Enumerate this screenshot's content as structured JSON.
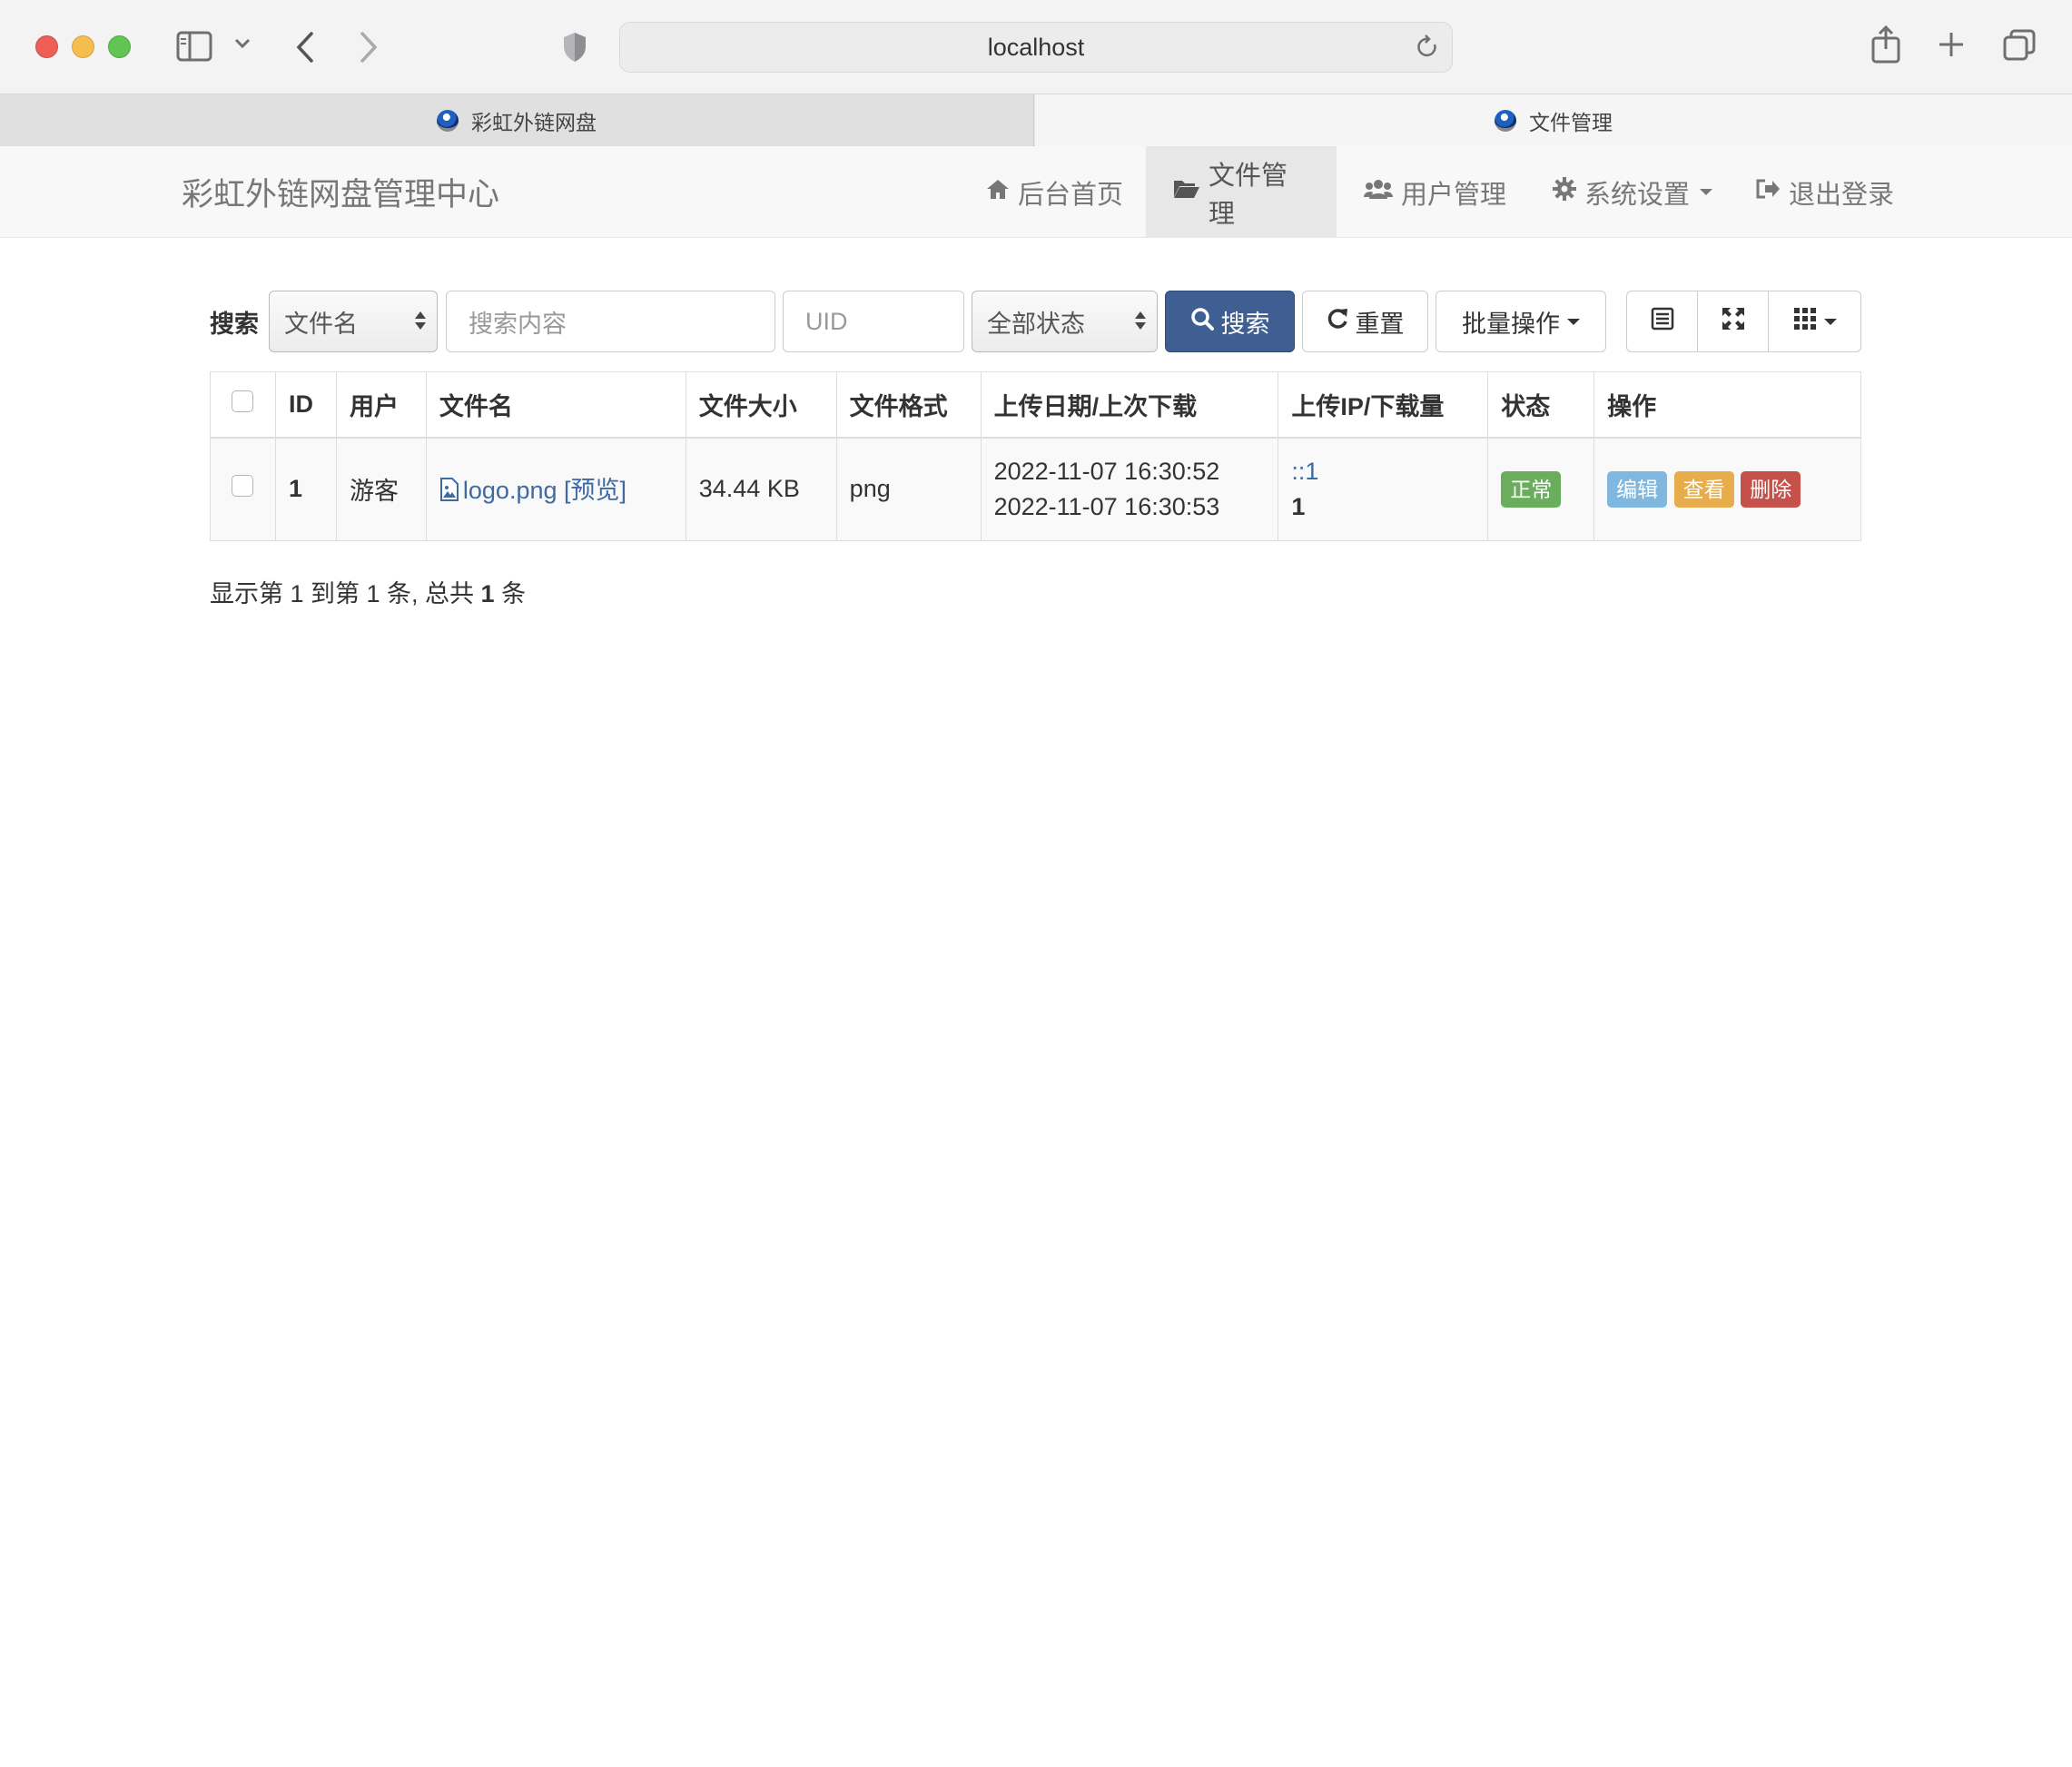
{
  "browser": {
    "url": "localhost",
    "tabs": [
      {
        "title": "彩虹外链网盘",
        "active": false
      },
      {
        "title": "文件管理",
        "active": true
      }
    ]
  },
  "navbar": {
    "brand": "彩虹外链网盘管理中心",
    "items": [
      {
        "label": "后台首页",
        "icon": "home-icon"
      },
      {
        "label": "文件管理",
        "icon": "folder-open-icon",
        "active": true
      },
      {
        "label": "用户管理",
        "icon": "users-icon"
      },
      {
        "label": "系统设置",
        "icon": "gear-icon",
        "dropdown": true
      },
      {
        "label": "退出登录",
        "icon": "logout-icon"
      }
    ]
  },
  "toolbar": {
    "search_label": "搜索",
    "field_select": "文件名",
    "keyword_placeholder": "搜索内容",
    "uid_placeholder": "UID",
    "status_select": "全部状态",
    "search_button": "搜索",
    "reset_button": "重置",
    "batch_button": "批量操作"
  },
  "table": {
    "columns": [
      "ID",
      "用户",
      "文件名",
      "文件大小",
      "文件格式",
      "上传日期/上次下载",
      "上传IP/下载量",
      "状态",
      "操作"
    ],
    "rows": [
      {
        "id": "1",
        "user": "游客",
        "filename": "logo.png",
        "preview": "[预览]",
        "size": "34.44 KB",
        "format": "png",
        "upload_date": "2022-11-07 16:30:52",
        "last_download": "2022-11-07 16:30:53",
        "upload_ip": "::1",
        "downloads": "1",
        "status": "正常",
        "actions": [
          "编辑",
          "查看",
          "删除"
        ]
      }
    ]
  },
  "pagination": {
    "prefix": "显示第 1 到第 1 条, 总共 ",
    "total": "1",
    "suffix": " 条"
  },
  "colors": {
    "primary": "#3f5f92",
    "success": "#6aad5d",
    "info": "#7fb7de",
    "warning": "#e7ad4d",
    "danger": "#c5514a",
    "link": "#3d6aa3"
  }
}
